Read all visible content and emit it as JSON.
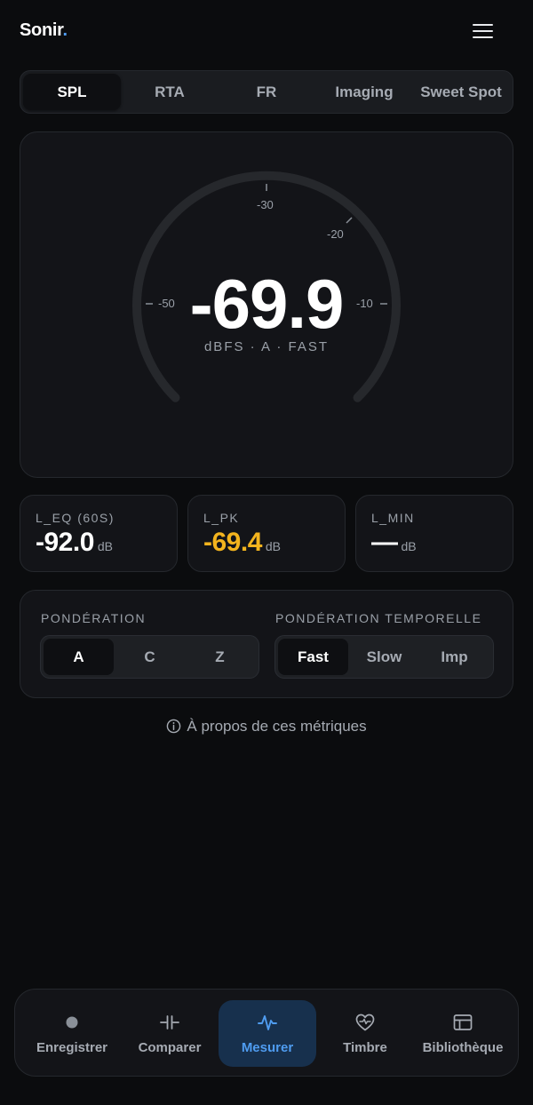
{
  "app": {
    "brand": "Sonir",
    "brand_dot": "."
  },
  "tabs": [
    {
      "label": "SPL",
      "active": true
    },
    {
      "label": "RTA",
      "active": false
    },
    {
      "label": "FR",
      "active": false
    },
    {
      "label": "Imaging",
      "active": false
    },
    {
      "label": "Sweet Spot",
      "active": false
    }
  ],
  "gauge": {
    "value": "-69.9",
    "unit": "dBFS · A · FAST",
    "ticks": [
      "-50",
      "-30",
      "-20",
      "-10"
    ]
  },
  "stats": [
    {
      "label": "L_EQ (60S)",
      "value": "-92.0",
      "unit": "dB"
    },
    {
      "label": "L_PK",
      "value": "-69.4",
      "unit": "dB"
    },
    {
      "label": "L_MIN",
      "value": "—",
      "unit": "dB"
    }
  ],
  "weighting": {
    "label": "PONDÉRATION",
    "options": [
      "A",
      "C",
      "Z"
    ],
    "selected": "A"
  },
  "time_weighting": {
    "label": "PONDÉRATION TEMPORELLE",
    "options": [
      "Fast",
      "Slow",
      "Imp"
    ],
    "selected": "Fast"
  },
  "about": {
    "label": "À propos de ces métriques"
  },
  "nav": [
    {
      "label": "Enregistrer",
      "icon": "record-icon",
      "active": false
    },
    {
      "label": "Comparer",
      "icon": "compare-icon",
      "active": false
    },
    {
      "label": "Mesurer",
      "icon": "waveform-icon",
      "active": true
    },
    {
      "label": "Timbre",
      "icon": "heart-pulse-icon",
      "active": false
    },
    {
      "label": "Bibliothèque",
      "icon": "library-icon",
      "active": false
    }
  ],
  "colors": {
    "accent": "#4f9cf0",
    "warning": "#f3b41e",
    "background": "#0b0c0e",
    "card": "#131418"
  }
}
